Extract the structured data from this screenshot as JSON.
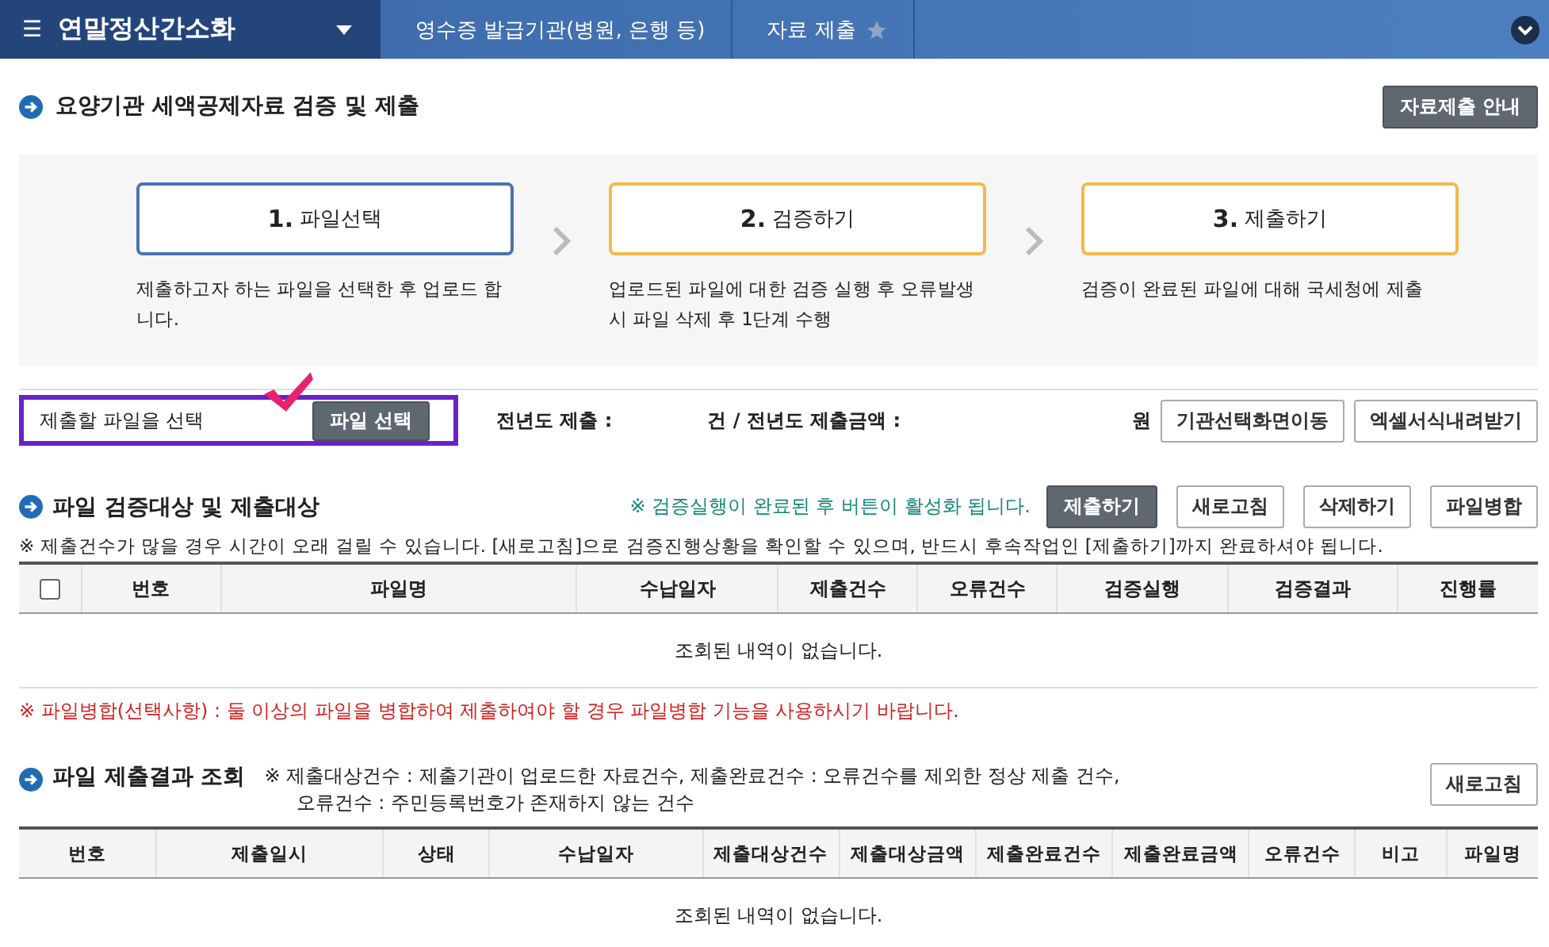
{
  "nav": {
    "menu_icon": "☰",
    "title": "연말정산간소화",
    "crumbs": [
      "영수증 발급기관(병원, 은행 등)",
      "자료 제출"
    ]
  },
  "page": {
    "title": "요양기관 세액공제자료 검증 및 제출",
    "guide_button": "자료제출 안내"
  },
  "steps": [
    {
      "num": "1.",
      "label": "파일선택",
      "desc": "제출하고자 하는 파일을 선택한 후 업로드 합니다.",
      "kind": "active"
    },
    {
      "num": "2.",
      "label": "검증하기",
      "desc": "업로드된 파일에 대한 검증 실행 후 오류발생 시 파일 삭제 후 1단계 수행",
      "kind": "pending"
    },
    {
      "num": "3.",
      "label": "제출하기",
      "desc": "검증이 완료된 파일에 대해 국세청에 제출",
      "kind": "pending"
    }
  ],
  "select_bar": {
    "label": "제출할 파일을 선택",
    "file_button": "파일 선택",
    "prev_count_label": "전년도 제출 :",
    "prev_amount_label": "건 / 전년도 제출금액 :",
    "won": "원",
    "buttons": [
      "기관선택화면이동",
      "엑셀서식내려받기"
    ]
  },
  "verify": {
    "title": "파일 검증대상 및 제출대상",
    "hint": "※ 검증실행이 완료된 후 버튼이 활성화 됩니다.",
    "buttons": [
      {
        "label": "제출하기",
        "kind": "primary"
      },
      {
        "label": "새로고침",
        "kind": "plain"
      },
      {
        "label": "삭제하기",
        "kind": "plain"
      },
      {
        "label": "파일병합",
        "kind": "plain"
      }
    ],
    "notice": "※ 제출건수가 많을 경우 시간이 오래 걸릴 수 있습니다. [새로고침]으로 검증진행상황을 확인할 수 있으며, 반드시 후속작업인 [제출하기]까지 완료하셔야 됩니다.",
    "table": {
      "select_all": {
        "checked": false
      },
      "columns": [
        "번호",
        "파일명",
        "수납일자",
        "제출건수",
        "오류건수",
        "검증실행",
        "검증결과",
        "진행률"
      ],
      "empty": "조회된 내역이 없습니다."
    },
    "merge_note": "※ 파일병합(선택사항) : 둘 이상의 파일을 병합하여 제출하여야 할 경우 파일병합 기능을 사용하시기 바랍니다."
  },
  "results": {
    "title": "파일 제출결과 조회",
    "note_lines": [
      "※ 제출대상건수 : 제출기관이 업로드한 자료건수, 제출완료건수 : 오류건수를 제외한 정상 제출 건수,",
      "오류건수 : 주민등록번호가 존재하지 않는 건수"
    ],
    "refresh": "새로고침",
    "table": {
      "columns": [
        "번호",
        "제출일시",
        "상태",
        "수납일자",
        "제출대상건수",
        "제출대상금액",
        "제출완료건수",
        "제출완료금액",
        "오류건수",
        "비고",
        "파일명"
      ],
      "empty": "조회된 내역이 없습니다."
    }
  }
}
